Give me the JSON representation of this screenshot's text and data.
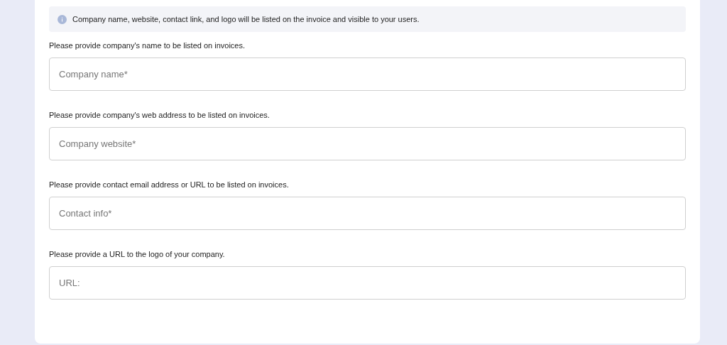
{
  "notice": {
    "text": "Company name, website, contact link, and logo will be listed on the invoice and visible to your users."
  },
  "fields": [
    {
      "label": "Please provide company's name to be listed on invoices.",
      "placeholder": "Company name*"
    },
    {
      "label": "Please provide company's web address to be listed on invoices.",
      "placeholder": "Company website*"
    },
    {
      "label": "Please provide contact email address or URL to be listed on invoices.",
      "placeholder": "Contact info*"
    },
    {
      "label": "Please provide a URL to the logo of your company.",
      "placeholder": "URL:"
    }
  ]
}
